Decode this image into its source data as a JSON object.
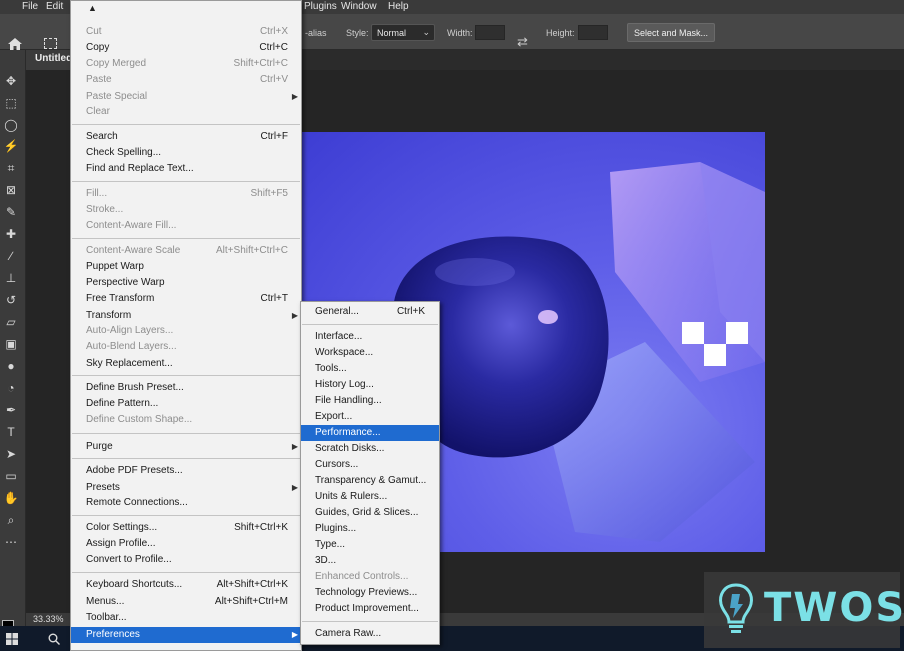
{
  "menubar": {
    "items": [
      "File",
      "Edit",
      "Plugins",
      "Window",
      "Help"
    ]
  },
  "options_bar": {
    "antialias_fragment": "-alias",
    "style_label": "Style:",
    "style_value": "Normal",
    "width_label": "Width:",
    "height_label": "Height:",
    "select_mask_label": "Select and Mask..."
  },
  "document": {
    "tab_title": "Untitled",
    "zoom": "33.33%"
  },
  "edit_menu": {
    "items": [
      {
        "label": "Cut",
        "shortcut": "Ctrl+X",
        "disabled": true
      },
      {
        "label": "Copy",
        "shortcut": "Ctrl+C",
        "disabled": false
      },
      {
        "label": "Copy Merged",
        "shortcut": "Shift+Ctrl+C",
        "disabled": true
      },
      {
        "label": "Paste",
        "shortcut": "Ctrl+V",
        "disabled": true
      },
      {
        "label": "Paste Special",
        "shortcut": "",
        "disabled": true,
        "submenu": true
      },
      {
        "label": "Clear",
        "shortcut": "",
        "disabled": true
      },
      {
        "label": "Search",
        "shortcut": "Ctrl+F",
        "disabled": false
      },
      {
        "label": "Check Spelling...",
        "shortcut": "",
        "disabled": false
      },
      {
        "label": "Find and Replace Text...",
        "shortcut": "",
        "disabled": false
      },
      {
        "label": "Fill...",
        "shortcut": "Shift+F5",
        "disabled": true
      },
      {
        "label": "Stroke...",
        "shortcut": "",
        "disabled": true
      },
      {
        "label": "Content-Aware Fill...",
        "shortcut": "",
        "disabled": true
      },
      {
        "label": "Content-Aware Scale",
        "shortcut": "Alt+Shift+Ctrl+C",
        "disabled": true
      },
      {
        "label": "Puppet Warp",
        "shortcut": "",
        "disabled": false
      },
      {
        "label": "Perspective Warp",
        "shortcut": "",
        "disabled": false
      },
      {
        "label": "Free Transform",
        "shortcut": "Ctrl+T",
        "disabled": false
      },
      {
        "label": "Transform",
        "shortcut": "",
        "disabled": false,
        "submenu": true
      },
      {
        "label": "Auto-Align Layers...",
        "shortcut": "",
        "disabled": true
      },
      {
        "label": "Auto-Blend Layers...",
        "shortcut": "",
        "disabled": true
      },
      {
        "label": "Sky Replacement...",
        "shortcut": "",
        "disabled": false
      },
      {
        "label": "Define Brush Preset...",
        "shortcut": "",
        "disabled": false
      },
      {
        "label": "Define Pattern...",
        "shortcut": "",
        "disabled": false
      },
      {
        "label": "Define Custom Shape...",
        "shortcut": "",
        "disabled": true
      },
      {
        "label": "Purge",
        "shortcut": "",
        "disabled": false,
        "submenu": true
      },
      {
        "label": "Adobe PDF Presets...",
        "shortcut": "",
        "disabled": false
      },
      {
        "label": "Presets",
        "shortcut": "",
        "disabled": false,
        "submenu": true
      },
      {
        "label": "Remote Connections...",
        "shortcut": "",
        "disabled": false
      },
      {
        "label": "Color Settings...",
        "shortcut": "Shift+Ctrl+K",
        "disabled": false
      },
      {
        "label": "Assign Profile...",
        "shortcut": "",
        "disabled": false
      },
      {
        "label": "Convert to Profile...",
        "shortcut": "",
        "disabled": false
      },
      {
        "label": "Keyboard Shortcuts...",
        "shortcut": "Alt+Shift+Ctrl+K",
        "disabled": false
      },
      {
        "label": "Menus...",
        "shortcut": "Alt+Shift+Ctrl+M",
        "disabled": false
      },
      {
        "label": "Toolbar...",
        "shortcut": "",
        "disabled": false
      },
      {
        "label": "Preferences",
        "shortcut": "",
        "disabled": false,
        "submenu": true,
        "highlighted": true
      }
    ]
  },
  "preferences_submenu": {
    "items": [
      {
        "label": "General...",
        "shortcut": "Ctrl+K",
        "disabled": false
      },
      {
        "label": "Interface...",
        "shortcut": "",
        "disabled": false
      },
      {
        "label": "Workspace...",
        "shortcut": "",
        "disabled": false
      },
      {
        "label": "Tools...",
        "shortcut": "",
        "disabled": false
      },
      {
        "label": "History Log...",
        "shortcut": "",
        "disabled": false
      },
      {
        "label": "File Handling...",
        "shortcut": "",
        "disabled": false
      },
      {
        "label": "Export...",
        "shortcut": "",
        "disabled": false
      },
      {
        "label": "Performance...",
        "shortcut": "",
        "disabled": false,
        "highlighted": true
      },
      {
        "label": "Scratch Disks...",
        "shortcut": "",
        "disabled": false
      },
      {
        "label": "Cursors...",
        "shortcut": "",
        "disabled": false
      },
      {
        "label": "Transparency & Gamut...",
        "shortcut": "",
        "disabled": false
      },
      {
        "label": "Units & Rulers...",
        "shortcut": "",
        "disabled": false
      },
      {
        "label": "Guides, Grid & Slices...",
        "shortcut": "",
        "disabled": false
      },
      {
        "label": "Plugins...",
        "shortcut": "",
        "disabled": false
      },
      {
        "label": "Type...",
        "shortcut": "",
        "disabled": false
      },
      {
        "label": "3D...",
        "shortcut": "",
        "disabled": false
      },
      {
        "label": "Enhanced Controls...",
        "shortcut": "",
        "disabled": true
      },
      {
        "label": "Technology Previews...",
        "shortcut": "",
        "disabled": false
      },
      {
        "label": "Product Improvement...",
        "shortcut": "",
        "disabled": false
      },
      {
        "label": "Camera Raw...",
        "shortcut": "",
        "disabled": false
      }
    ]
  },
  "tools": [
    "move-icon",
    "marquee-icon",
    "lasso-icon",
    "quick-select-icon",
    "crop-icon",
    "frame-icon",
    "eyedropper-icon",
    "healing-icon",
    "brush-icon",
    "stamp-icon",
    "history-brush-icon",
    "eraser-icon",
    "gradient-icon",
    "blur-icon",
    "dodge-icon",
    "pen-icon",
    "type-icon",
    "path-select-icon",
    "rectangle-icon",
    "hand-icon",
    "zoom-icon",
    "more-tools-icon"
  ],
  "watermark": {
    "text": "TWOS"
  },
  "colors": {
    "menu_highlight": "#1f6bd0",
    "canvas_blue": "#5e5ee8",
    "watermark_teal": "#7be0e6"
  }
}
